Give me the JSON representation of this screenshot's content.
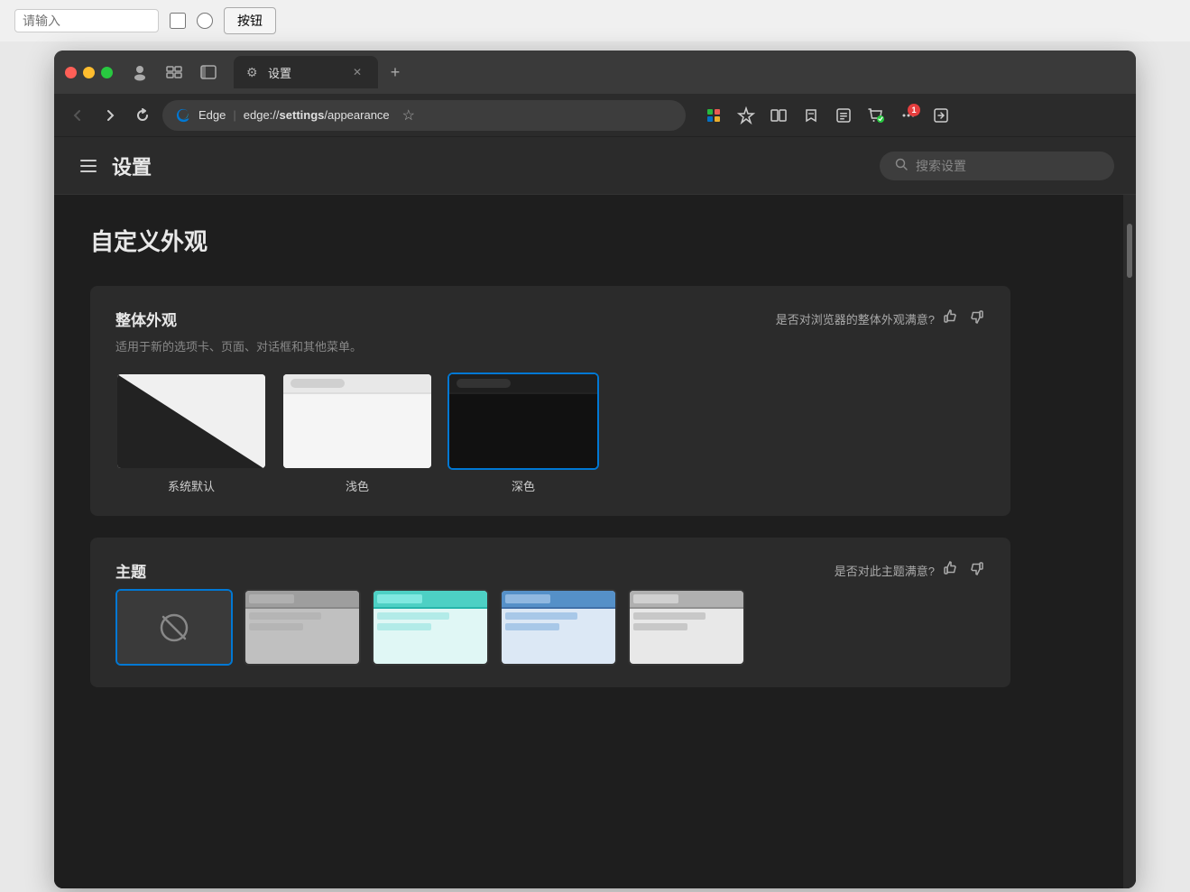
{
  "topbar": {
    "input_placeholder": "请输入",
    "button_label": "按钮"
  },
  "browser": {
    "traffic_lights": [
      "red",
      "yellow",
      "green"
    ],
    "tab": {
      "icon": "⚙",
      "title": "设置",
      "close": "✕"
    },
    "new_tab_icon": "+",
    "nav": {
      "back": "←",
      "forward": "→",
      "refresh": "↻"
    },
    "address": {
      "brand": "Edge",
      "url_prefix": "edge://",
      "url_bold": "settings",
      "url_suffix": "/appearance"
    },
    "toolbar_icons": [
      "⊞",
      "🛡",
      "◫",
      "☆☆",
      "📋",
      "🤝",
      "···",
      "⊡"
    ]
  },
  "settings": {
    "header": {
      "hamburger": "☰",
      "title": "设置",
      "search_placeholder": "搜索设置"
    },
    "page_title": "自定义外观",
    "appearance_section": {
      "title": "整体外观",
      "subtitle": "适用于新的选项卡、页面、对话框和其他菜单。",
      "feedback_label": "是否对浏览器的整体外观满意?",
      "options": [
        {
          "id": "system",
          "label": "系统默认",
          "selected": false
        },
        {
          "id": "light",
          "label": "浅色",
          "selected": false
        },
        {
          "id": "dark",
          "label": "深色",
          "selected": true
        }
      ]
    },
    "theme_section": {
      "title": "主题",
      "feedback_label": "是否对此主题满意?",
      "thumbs": [
        {
          "id": "none",
          "type": "none",
          "active": true
        },
        {
          "id": "gray",
          "type": "gray",
          "active": false
        },
        {
          "id": "teal",
          "type": "teal",
          "active": false
        },
        {
          "id": "blue",
          "type": "blue",
          "active": false
        },
        {
          "id": "gray2",
          "type": "gray2",
          "active": false
        }
      ]
    }
  }
}
